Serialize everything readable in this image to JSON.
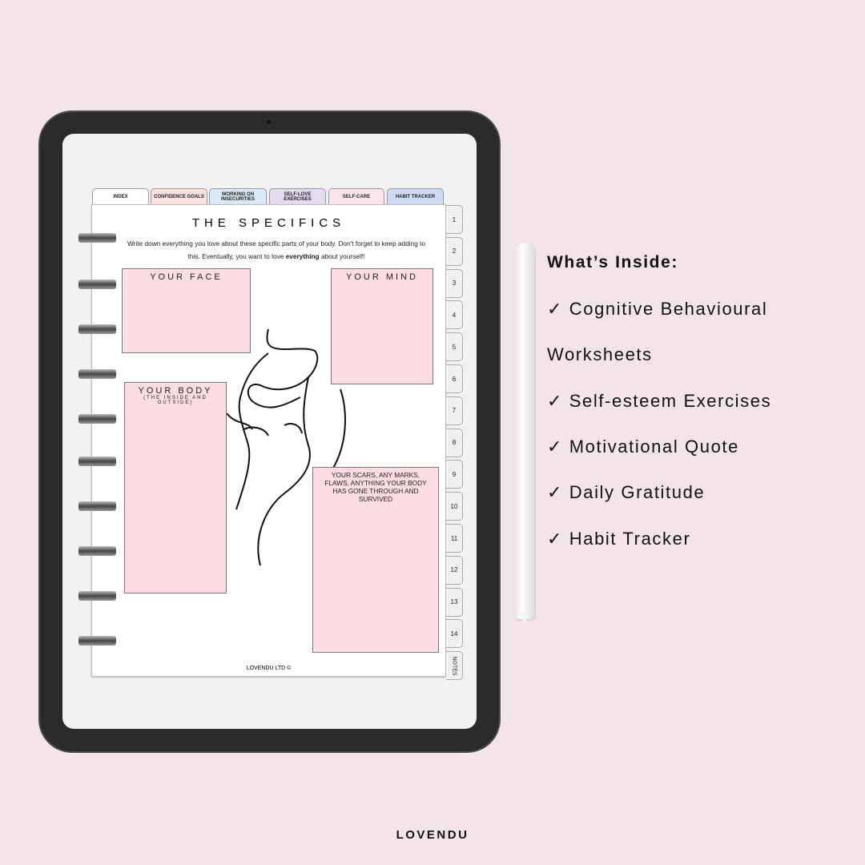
{
  "planner": {
    "top_tabs": [
      {
        "label": "INDEX",
        "color": "#ffffff"
      },
      {
        "label": "CONFIDENCE GOALS",
        "color": "#fde0e0"
      },
      {
        "label": "WORKING ON INSECURITIES",
        "color": "#d9e9f7"
      },
      {
        "label": "SELF-LOVE EXERCISES",
        "color": "#e3dcf1"
      },
      {
        "label": "SELF-CARE",
        "color": "#fde5ef"
      },
      {
        "label": "HABIT TRACKER",
        "color": "#cfdaf5"
      }
    ],
    "side_tabs": [
      "1",
      "2",
      "3",
      "4",
      "5",
      "6",
      "7",
      "8",
      "9",
      "10",
      "11",
      "12",
      "13",
      "14",
      "NOTES"
    ],
    "title": "THE SPECIFICS",
    "intro_before": "Write down everything you love about these specific parts of your body. Don't forget to keep adding to this. Eventually, you want to love ",
    "intro_bold": "everything",
    "intro_after": " about yourself!",
    "boxes": {
      "face": "YOUR FACE",
      "mind": "YOUR MIND",
      "body": "YOUR BODY",
      "body_sub": "(THE INSIDE AND OUTSIDE)",
      "scars": "YOUR SCARS, ANY MARKS, FLAWS, ANYTHING YOUR BODY HAS GONE THROUGH AND SURVIVED"
    },
    "footer": "LOVENDU LTD ©"
  },
  "features": {
    "heading": "What’s Inside:",
    "items": [
      "✓ Cognitive Behavioural",
      "Worksheets",
      "✓ Self-esteem Exercises",
      "✓ Motivational Quote",
      "✓ Daily Gratitude",
      "✓ Habit Tracker"
    ]
  },
  "brand": "LOVENDU"
}
